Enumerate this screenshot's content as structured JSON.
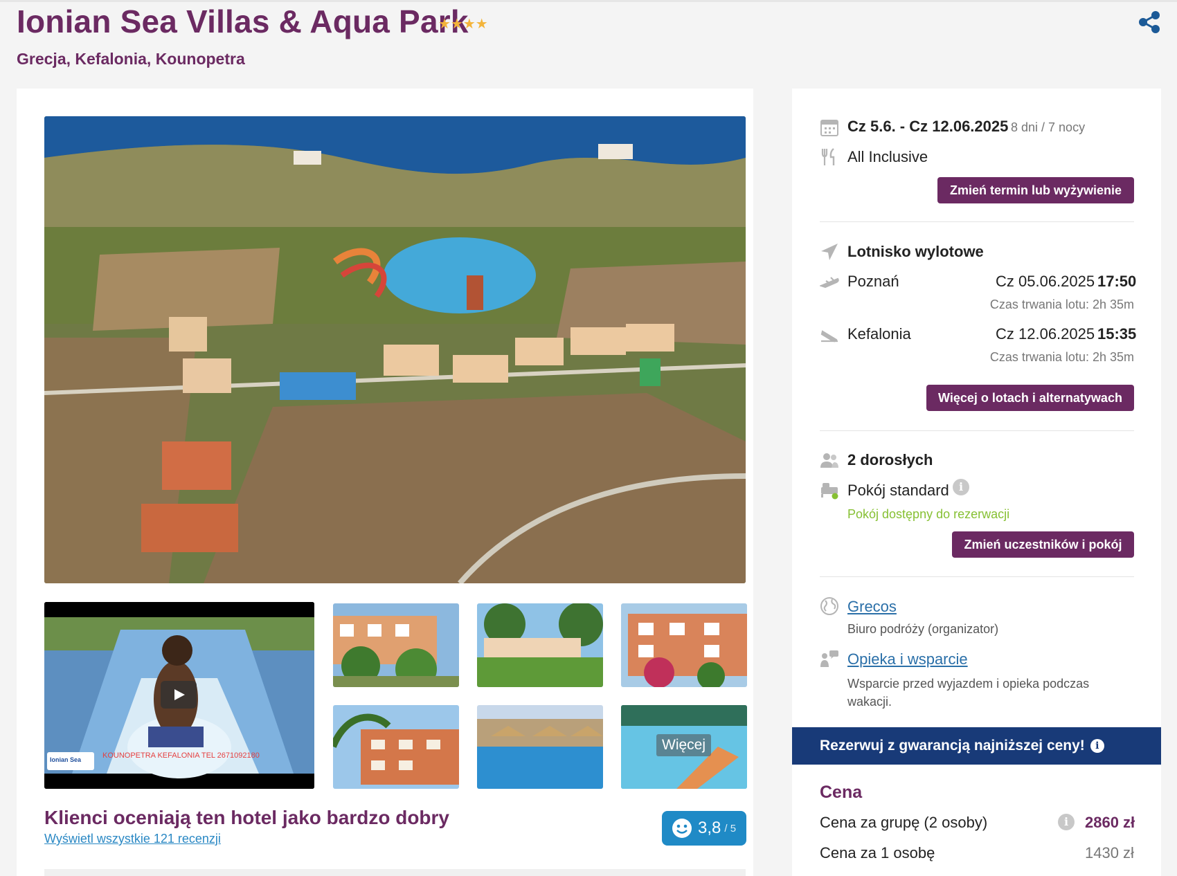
{
  "header": {
    "hotel_name": "Ionian Sea Villas & Aqua Park",
    "stars": "★★★★",
    "star_rating": 4,
    "location": "Grecja, Kefalonia, Kounopetra",
    "share_icon": "share-icon"
  },
  "gallery": {
    "more_label": "Więcej",
    "video_caption": "KOUNOPETRA   KEFALONIA   TEL 2671092180",
    "video_logo": "Ionian Sea"
  },
  "reviews": {
    "headline": "Klienci oceniają ten hotel jako bardzo dobry",
    "link": "Wyświetl wszystkie 121 recenzji",
    "score": "3,8",
    "max": "/ 5"
  },
  "trip": {
    "dates": "Cz 5.6. - Cz 12.06.2025",
    "duration": "8 dni / 7 nocy",
    "board": "All Inclusive",
    "change_button": "Zmień termin lub wyżywienie"
  },
  "flights": {
    "title": "Lotnisko wylotowe",
    "outbound": {
      "city": "Poznań",
      "date": "Cz 05.06.2025",
      "time": "17:50",
      "duration": "Czas trwania lotu: 2h 35m"
    },
    "inbound": {
      "city": "Kefalonia",
      "date": "Cz 12.06.2025",
      "time": "15:35",
      "duration": "Czas trwania lotu: 2h 35m"
    },
    "more_button": "Więcej o lotach i alternatywach"
  },
  "room": {
    "guests": "2 dorosłych",
    "type": "Pokój standard",
    "availability": "Pokój dostępny do rezerwacji",
    "change_button": "Zmień uczestników i pokój"
  },
  "organizer": {
    "name": "Grecos",
    "role": "Biuro podróży (organizator)",
    "support_link": "Opieka i wsparcie",
    "support_desc": "Wsparcie przed wyjazdem i opieka podczas wakacji."
  },
  "booking": {
    "guarantee": "Rezerwuj z gwarancją najniższej ceny!",
    "price_title": "Cena",
    "group_label": "Cena za grupę (2 osoby)",
    "group_price": "2860 zł",
    "person_label": "Cena za 1 osobę",
    "person_price": "1430 zł"
  },
  "colors": {
    "brand": "#6b2a62",
    "accent_blue": "#183a78",
    "link": "#2a6fa8",
    "available": "#86c033"
  }
}
